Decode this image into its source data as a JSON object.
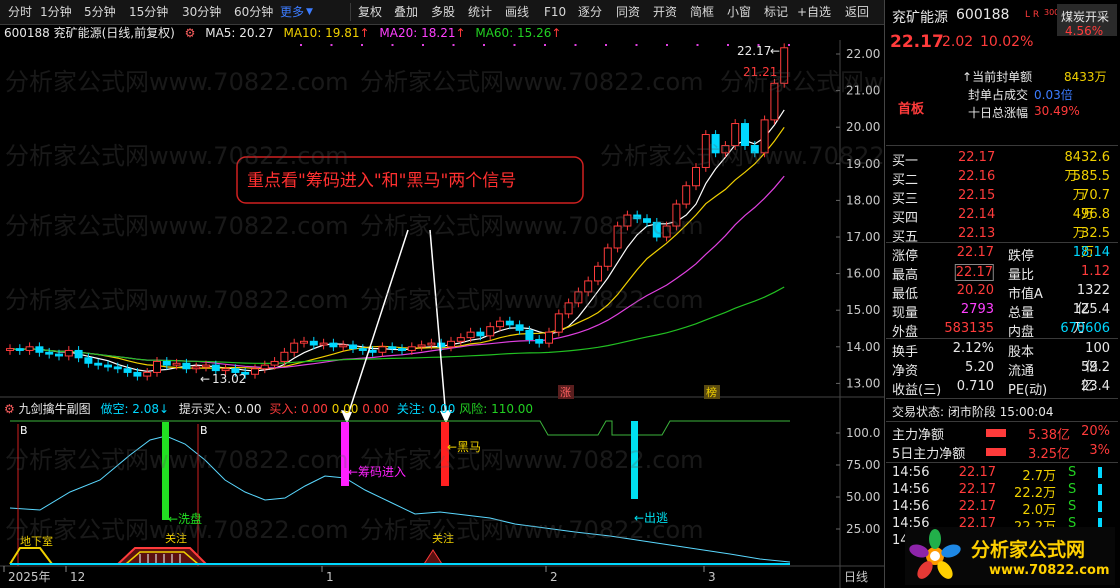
{
  "toolbar": {
    "periods": [
      "分时",
      "1分钟",
      "5分钟",
      "15分钟",
      "30分钟",
      "60分钟",
      "更多"
    ],
    "tools": [
      "复权",
      "叠加",
      "多股",
      "统计",
      "画线",
      "F10",
      "逐分",
      "同资",
      "开资",
      "简框",
      "小窗",
      "标记",
      "+自选",
      "返回"
    ]
  },
  "chart_header": {
    "title": "600188 兖矿能源(日线,前复权)",
    "ma5": "MA5: 20.27",
    "ma10": "MA10: 19.81",
    "ma20": "MA20: 18.21",
    "ma60": "MA60: 15.26"
  },
  "indicator_header": {
    "name": "九剑擒牛副图",
    "items": [
      "做空: 2.08",
      "提示买入: 0.00",
      "买入: 0.00",
      "0.00",
      "0.00",
      "关注: 0.00",
      "风险: 110.00"
    ]
  },
  "annotation_text": "重点看\"筹码进入\"和\"黑马\"两个信号",
  "price_axis": [
    "22.00",
    "21.00",
    "20.00",
    "19.00",
    "18.00",
    "17.00",
    "16.00",
    "15.00",
    "14.00",
    "13.00"
  ],
  "ind_axis": [
    "100.0",
    "75.00",
    "50.00",
    "25.00"
  ],
  "date_axis": [
    "2025年",
    "12",
    "1",
    "2",
    "3"
  ],
  "date_axis_right": "日线",
  "price_labels": {
    "high": "22.17",
    "high2": "21.21",
    "low": "13.02"
  },
  "markers": {
    "zhang": "涨",
    "bang": "榜"
  },
  "signals": {
    "b1": "B",
    "b2": "B",
    "xipan": "洗盘",
    "chouma": "筹码进入",
    "heima": "黑马",
    "chutao": "出逃",
    "dixiashi": "地下室",
    "guanzhu1": "关注",
    "guanzhu2": "关注"
  },
  "stock": {
    "name": "兖矿能源",
    "code": "600188",
    "flags": "L R",
    "badge_num": "300",
    "sector": "煤炭开采",
    "sector_change": "4.56%",
    "price": "22.17",
    "change": "2.02",
    "change_pct": "10.02%",
    "status": "首板",
    "seal_amount_label": "当前封单额",
    "seal_amount": "8433万",
    "seal_ratio_label": "封单占成交",
    "seal_ratio": "0.03倍",
    "ten_day_label": "十日总涨幅",
    "ten_day": "30.49%"
  },
  "order_book": [
    {
      "label": "买一",
      "price": "22.17",
      "volume": "8432.6万"
    },
    {
      "label": "买二",
      "price": "22.16",
      "volume": "585.5万"
    },
    {
      "label": "买三",
      "price": "22.15",
      "volume": "70.7万"
    },
    {
      "label": "买四",
      "price": "22.14",
      "volume": "496.8万"
    },
    {
      "label": "买五",
      "price": "22.13",
      "volume": "32.5万"
    }
  ],
  "stats": [
    {
      "l1": "涨停",
      "v1": "22.17",
      "l2": "跌停",
      "v2": "18.14"
    },
    {
      "l1": "最高",
      "v1": "22.17",
      "l2": "量比",
      "v2": "1.12"
    },
    {
      "l1": "最低",
      "v1": "20.20",
      "l2": "市值A",
      "v2": "1322亿"
    },
    {
      "l1": "现量",
      "v1": "2793",
      "l2": "总量",
      "v2": "125.4万"
    },
    {
      "l1": "外盘",
      "v1": "583135",
      "l2": "内盘",
      "v2": "670606"
    }
  ],
  "stats2": [
    {
      "l1": "换手",
      "v1": "2.12%",
      "l2": "股本",
      "v2": "100亿"
    },
    {
      "l1": "净资",
      "v1": "5.20",
      "l2": "流通",
      "v2": "59.2亿"
    },
    {
      "l1": "收益(三)",
      "v1": "0.710",
      "l2": "PE(动)",
      "v2": "23.4"
    }
  ],
  "trade_status": "交易状态: 闭市阶段 15:00:04",
  "fund_flow": [
    {
      "label": "主力净额",
      "value": "5.38亿",
      "pct": "20%"
    },
    {
      "label": "5日主力净额",
      "value": "3.25亿",
      "pct": "3%"
    }
  ],
  "ticks": [
    {
      "time": "14:56",
      "price": "22.17",
      "vol": "2.7万",
      "side": "S"
    },
    {
      "time": "14:56",
      "price": "22.17",
      "vol": "22.2万",
      "side": "S"
    },
    {
      "time": "14:56",
      "price": "22.17",
      "vol": "2.0万",
      "side": "S"
    },
    {
      "time": "14:56",
      "price": "22.17",
      "vol": "22.2万",
      "side": "S"
    },
    {
      "time": "14:56",
      "price": "22.17",
      "vol": "",
      "side": ""
    }
  ],
  "logo": {
    "text": "分析家公式网",
    "url": "www.70822.com"
  },
  "watermark": "分析家公式网www.70822.com",
  "colors": {
    "up": "#ff3b3b",
    "down": "#00d8ff",
    "ma5": "#ffffff",
    "ma10": "#f0d000",
    "ma20": "#e040e0",
    "ma60": "#22c022"
  }
}
